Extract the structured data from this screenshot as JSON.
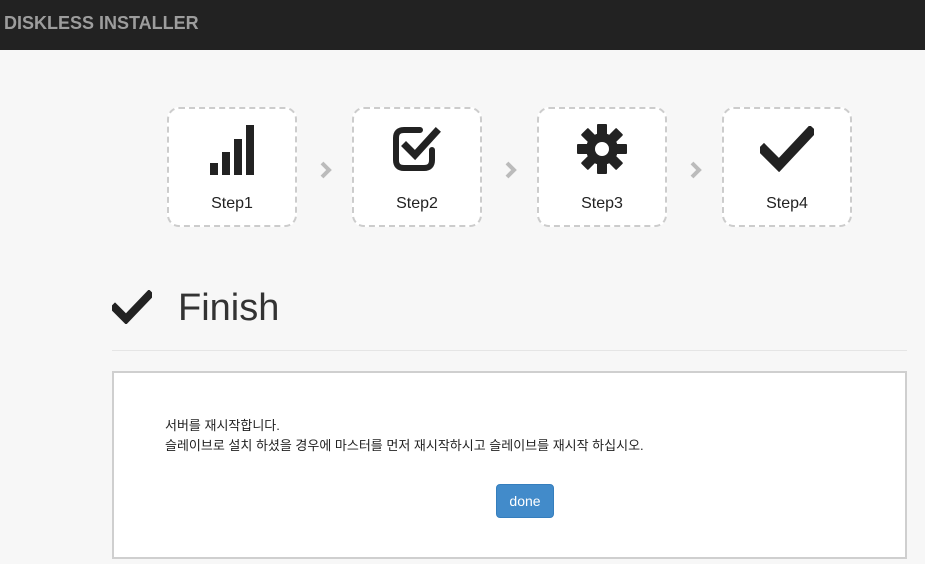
{
  "header": {
    "brand": "DISKLESS INSTALLER"
  },
  "steps": [
    {
      "label": "Step1",
      "icon": "signal-bars-icon"
    },
    {
      "label": "Step2",
      "icon": "checkbox-checked-icon"
    },
    {
      "label": "Step3",
      "icon": "gear-icon"
    },
    {
      "label": "Step4",
      "icon": "checkmark-icon"
    }
  ],
  "section": {
    "title": "Finish",
    "icon": "checkmark-icon"
  },
  "message": {
    "line1": "서버를 재시작합니다.",
    "line2": "슬레이브로 설치 하셨을 경우에 마스터를 먼저 재시작하시고 슬레이브를 재시작 하십시오."
  },
  "actions": {
    "done_label": "done"
  },
  "colors": {
    "topbar": "#222222",
    "brand_text": "#9d9d9d",
    "primary_button": "#428bca",
    "background": "#f7f7f7"
  }
}
